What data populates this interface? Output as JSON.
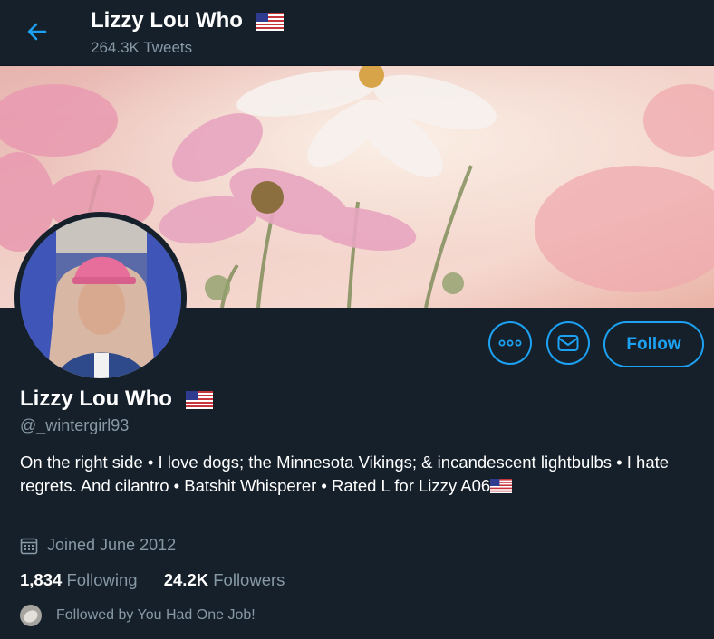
{
  "header": {
    "title": "Lizzy Lou Who",
    "tweet_count": "264.3K Tweets",
    "back_icon": "arrow-left-icon"
  },
  "profile": {
    "name": "Lizzy Lou Who",
    "handle": "@_wintergirl93",
    "bio": "On the right side • I love dogs; the Minnesota Vikings; & incandescent lightbulbs • I hate regrets. And cilantro • Batshit Whisperer • Rated L for Lizzy A06",
    "joined": "Joined June 2012",
    "following_count": "1,834",
    "following_label": "Following",
    "followers_count": "24.2K",
    "followers_label": "Followers",
    "followed_by": "Followed by You Had One Job!"
  },
  "actions": {
    "more_icon": "more-icon",
    "message_icon": "envelope-icon",
    "follow_label": "Follow"
  },
  "colors": {
    "background": "#15202b",
    "accent": "#1da1f2",
    "muted": "#8899a6",
    "text": "#ffffff"
  }
}
